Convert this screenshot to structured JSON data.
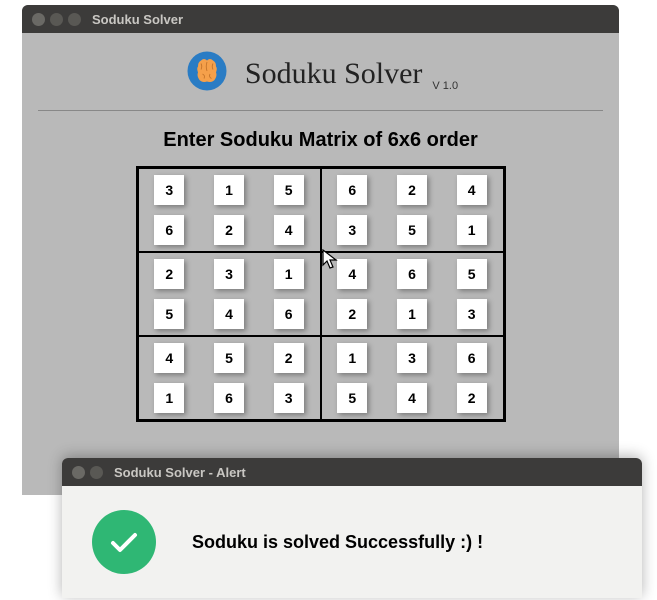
{
  "window": {
    "title": "Soduku Solver"
  },
  "header": {
    "app_title": "Soduku  Solver",
    "version": "V 1.0"
  },
  "instruction": "Enter Soduku Matrix of 6x6 order",
  "grid": {
    "rows": [
      [
        "3",
        "1",
        "5",
        "6",
        "2",
        "4"
      ],
      [
        "6",
        "2",
        "4",
        "3",
        "5",
        "1"
      ],
      [
        "2",
        "3",
        "1",
        "4",
        "6",
        "5"
      ],
      [
        "5",
        "4",
        "6",
        "2",
        "1",
        "3"
      ],
      [
        "4",
        "5",
        "2",
        "1",
        "3",
        "6"
      ],
      [
        "1",
        "6",
        "3",
        "5",
        "4",
        "2"
      ]
    ]
  },
  "alert": {
    "title": "Soduku Solver - Alert",
    "message": "Soduku is solved Successfully :) !"
  },
  "colors": {
    "success": "#2fb774",
    "titlebar": "#3c3b3a",
    "window_bg": "#b9b9b9"
  }
}
